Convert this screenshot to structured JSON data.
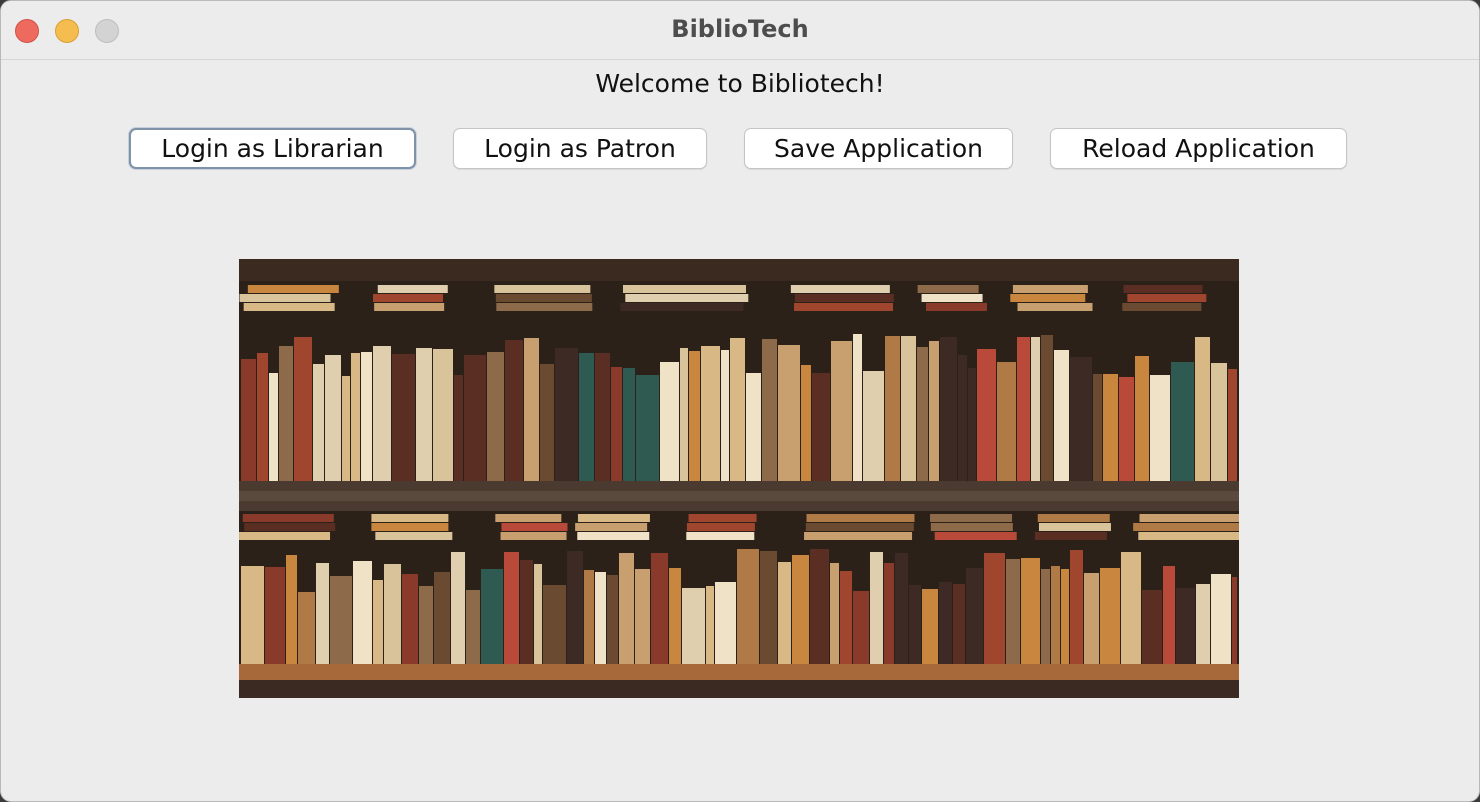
{
  "window": {
    "title": "BiblioTech",
    "controls": [
      "close",
      "minimize",
      "maximize"
    ]
  },
  "main": {
    "welcome_text": "Welcome to Bibliotech!",
    "buttons": [
      {
        "label": "Login as Librarian",
        "focused": true
      },
      {
        "label": "Login as Patron"
      },
      {
        "label": "Save Application"
      },
      {
        "label": "Reload Application"
      }
    ],
    "image": {
      "subject": "bookshelf-photo"
    }
  },
  "colors": {
    "window_bg": "#ececec",
    "close": "#ee6a5f",
    "minimize": "#f5bd4f",
    "maximize_disabled": "#d3d3d3",
    "focus_ring": "#7f93a8"
  }
}
